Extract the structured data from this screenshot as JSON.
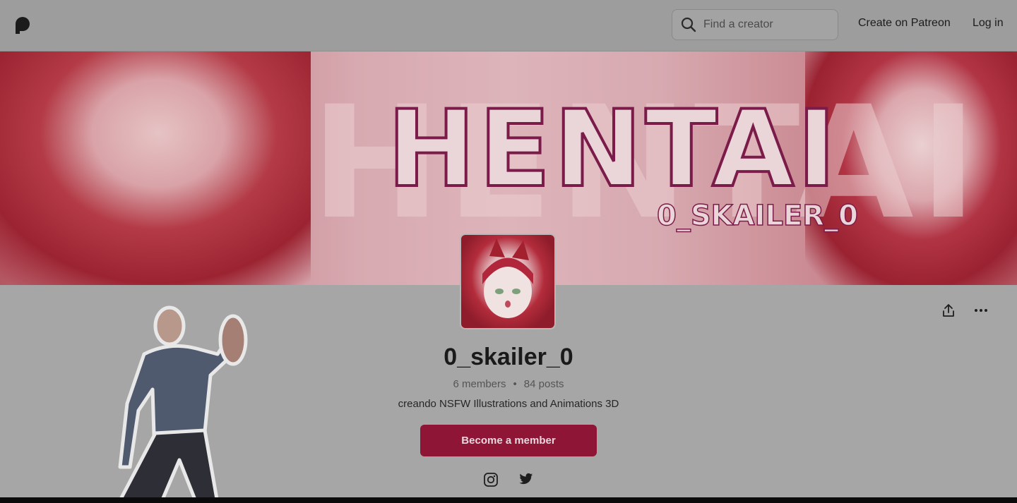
{
  "header": {
    "logo_icon": "patreon-logo-icon",
    "search_placeholder": "Find a creator",
    "create_link": "Create on Patreon",
    "login_link": "Log in"
  },
  "banner": {
    "title_text": "HENTAI",
    "handle_text": "0_SKAILER_0"
  },
  "profile": {
    "name": "0_skailer_0",
    "members": "6 members",
    "separator": "•",
    "posts": "84 posts",
    "tagline": "creando NSFW Illustrations and Animations 3D",
    "cta": "Become a member",
    "share_icon": "share-icon",
    "more_icon": "more-options-icon",
    "social": [
      "instagram-icon",
      "twitter-icon"
    ]
  },
  "colors": {
    "accent": "#8f1536",
    "background": "#a6a6a6"
  }
}
